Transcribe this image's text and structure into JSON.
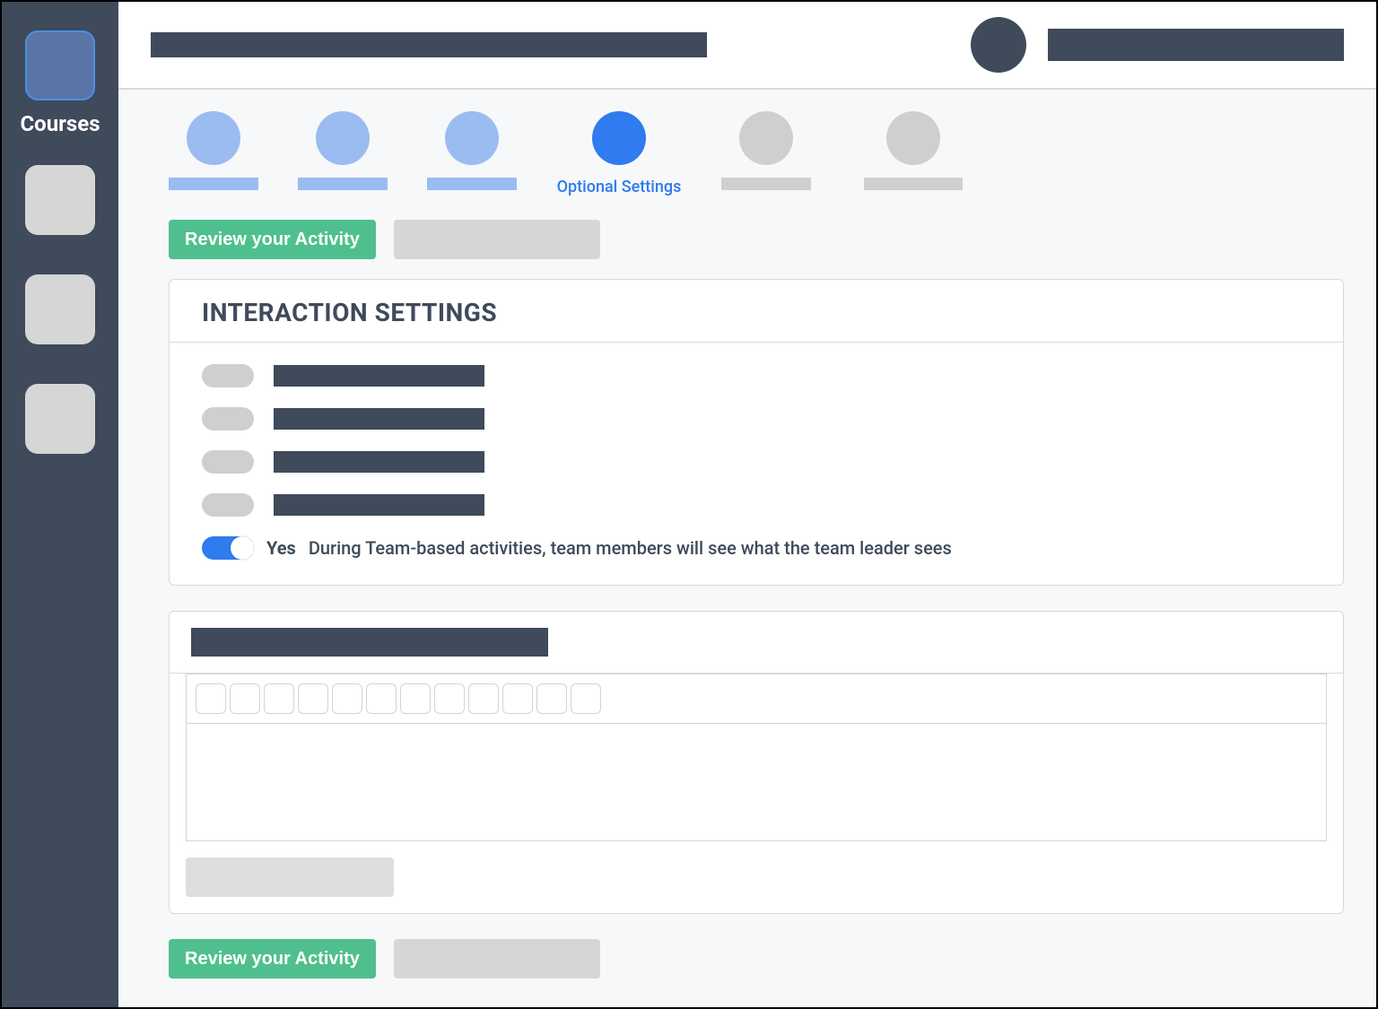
{
  "sidebar": {
    "active_label": "Courses"
  },
  "stepper": {
    "active_step_label": "Optional Settings"
  },
  "actions": {
    "review_label": "Review your Activity"
  },
  "interaction_card": {
    "title": "INTERACTION SETTINGS",
    "featured_toggle": {
      "state_label": "Yes",
      "description": "During Team-based activities, team members will see what the team leader sees"
    }
  }
}
